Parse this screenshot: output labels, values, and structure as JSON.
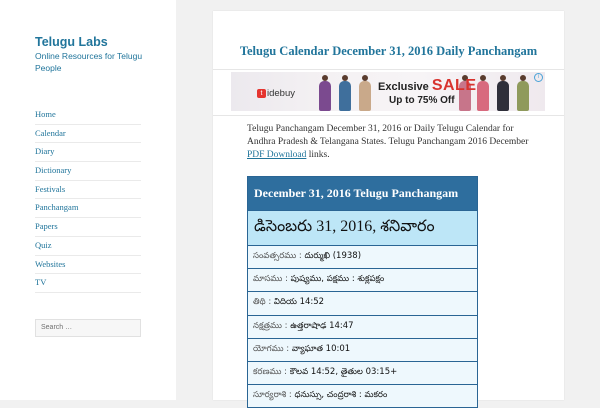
{
  "site": {
    "title": "Telugu Labs",
    "description": "Online Resources for Telugu People"
  },
  "nav": {
    "items": [
      "Home",
      "Calendar",
      "Diary",
      "Dictionary",
      "Festivals",
      "Panchangam",
      "Papers",
      "Quiz",
      "Websites",
      "TV"
    ]
  },
  "search": {
    "placeholder": "Search …"
  },
  "post": {
    "title": "Telugu Calendar December 31, 2016 Daily Panchangam",
    "intro_text": "Telugu Panchangam December 31, 2016 or Daily Telugu Calendar for Andhra Pradesh & Telangana States. Telugu Panchangam 2016 December",
    "pdf_link": "PDF Download",
    "intro_tail": " links."
  },
  "ad": {
    "brand": "idebuy",
    "brand_mark": "t",
    "headline_pre": "Exclusive ",
    "headline_sale": "SALE",
    "subline": "Up to 75% Off",
    "info": "i"
  },
  "calendar": {
    "heading": "December 31, 2016 Telugu Panchangam",
    "date_telugu": "డిసెంబరు 31, 2016, శనివారం",
    "rows": [
      {
        "label": "సంవత్సరము : ",
        "value": "దుర్ముఖి (1938)"
      },
      {
        "label": "మాసము : ",
        "value": "పుష్యము, పక్షము : శుక్లపక్షం"
      },
      {
        "label": "తిథి : ",
        "value": "విదియ 14:52"
      },
      {
        "label": "నక్షత్రము : ",
        "value": "ఉత్తరాషాఢ 14:47"
      },
      {
        "label": "యోగము : ",
        "value": "వ్యాఘాత 10:01"
      },
      {
        "label": "కరణము : ",
        "value": "కౌలవ 14:52, తైతుల 03:15+"
      },
      {
        "label": "సూర్యరాశి : ",
        "value": "ధనుస్సు, చంద్రరాశి : మకరం"
      }
    ]
  },
  "colors": {
    "link": "#21759b",
    "table_header": "#2e6e9e",
    "table_date_bg": "#bde6f7",
    "sale_red": "#d8332e"
  }
}
